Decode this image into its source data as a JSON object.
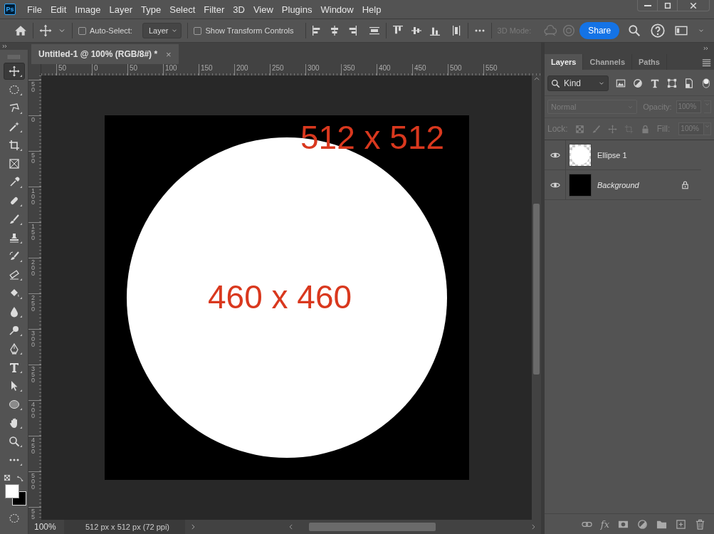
{
  "app_icon": "Ps",
  "menu": [
    "File",
    "Edit",
    "Image",
    "Layer",
    "Type",
    "Select",
    "Filter",
    "3D",
    "View",
    "Plugins",
    "Window",
    "Help"
  ],
  "options_bar": {
    "auto_select": {
      "label": "Auto-Select:",
      "checked": false
    },
    "target": "Layer",
    "transform_controls": {
      "label": "Show Transform Controls",
      "checked": false
    },
    "mode_label": "3D Mode:",
    "share": "Share"
  },
  "document_tab": {
    "title": "Untitled-1 @ 100% (RGB/8#) *",
    "close": "×"
  },
  "rulers": {
    "horizontal": [
      "50",
      "0",
      "50",
      "100",
      "150",
      "200",
      "250",
      "300",
      "350",
      "400",
      "450",
      "500",
      "550"
    ],
    "vertical": [
      "50",
      "0",
      "50",
      "100",
      "150",
      "200",
      "250",
      "300",
      "350",
      "400",
      "450",
      "500",
      "55"
    ]
  },
  "tools": [
    {
      "kind": "move",
      "selected": true
    },
    {
      "kind": "marquee",
      "selected": false
    },
    {
      "kind": "lasso",
      "selected": false
    },
    {
      "kind": "magic-wand",
      "selected": false
    },
    {
      "kind": "crop",
      "selected": false
    },
    {
      "kind": "frame",
      "selected": false
    },
    {
      "kind": "eyedropper",
      "selected": false
    },
    {
      "kind": "bandage",
      "selected": false
    },
    {
      "kind": "brush",
      "selected": false
    },
    {
      "kind": "stamp",
      "selected": false
    },
    {
      "kind": "history-brush",
      "selected": false
    },
    {
      "kind": "eraser",
      "selected": false
    },
    {
      "kind": "paint-bucket",
      "selected": false
    },
    {
      "kind": "drop",
      "selected": false
    },
    {
      "kind": "dodge",
      "selected": false
    },
    {
      "kind": "pen",
      "selected": false
    },
    {
      "kind": "type",
      "selected": false
    },
    {
      "kind": "arrow-cursor",
      "selected": false
    },
    {
      "kind": "ellipse",
      "selected": false
    },
    {
      "kind": "hand",
      "selected": false
    },
    {
      "kind": "zoom",
      "selected": false
    },
    {
      "kind": "more",
      "selected": false
    }
  ],
  "canvas": {
    "labels": [
      "512 x 512",
      "460 x 460"
    ]
  },
  "status_bar": {
    "zoom": "100%",
    "info": "512 px x 512 px (72 ppi)"
  },
  "panel": {
    "tabs": [
      {
        "label": "Layers",
        "selected": true
      },
      {
        "label": "Channels",
        "selected": false
      },
      {
        "label": "Paths",
        "selected": false
      }
    ],
    "filter": "Kind",
    "blend_mode": {
      "value": "Normal",
      "disabled": true
    },
    "opacity": {
      "label": "Opacity:",
      "value": "100%",
      "disabled": true
    },
    "lock_label": "Lock:",
    "fill": {
      "label": "Fill:",
      "value": "100%",
      "disabled": true
    },
    "layers": [
      {
        "name": "Ellipse 1",
        "kind": "shape",
        "visible": true,
        "locked": false
      },
      {
        "name": "Background",
        "kind": "background",
        "visible": true,
        "locked": true
      }
    ],
    "fx": "fx"
  }
}
